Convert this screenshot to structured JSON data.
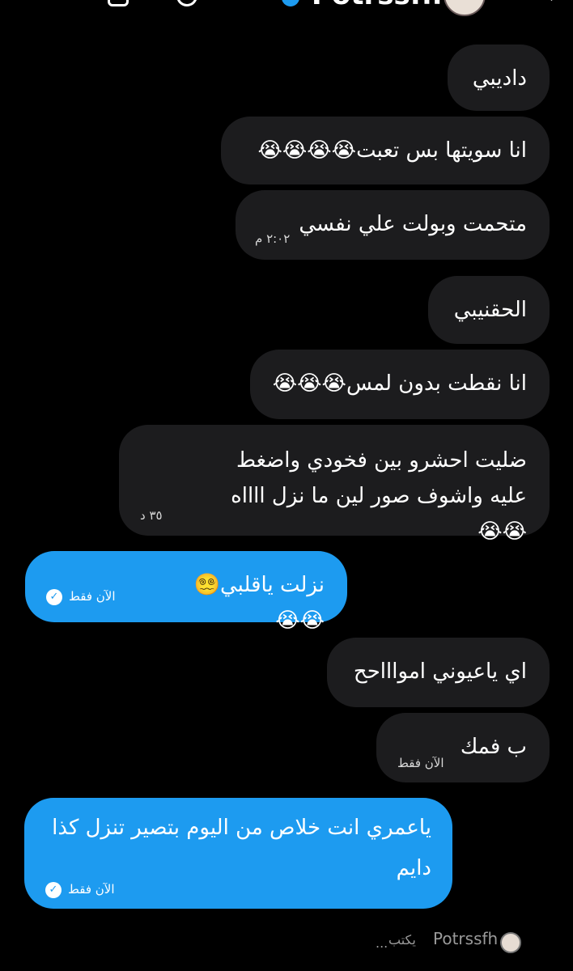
{
  "header": {
    "name": "Potrssfh"
  },
  "messages": [
    {
      "text": "داديبي",
      "emoji": "",
      "meta": ""
    },
    {
      "text": "انا سويتها بس تعبت",
      "emoji": "😭😭😭😭",
      "meta": ""
    },
    {
      "text": "متحمت وبولت علي نفسي",
      "emoji": "",
      "meta": "٢:٠٢ م"
    },
    {
      "text": "الحقنيبي",
      "emoji": "",
      "meta": ""
    },
    {
      "text": "انا نقطت بدون لمس",
      "emoji": "😭😭😭",
      "meta": ""
    },
    {
      "text": "ضليت احشرو بين فخودي واضغط عليه واشوف صور لين ما نزل ااااه",
      "emoji": "😭😭",
      "meta": "٣٥ د"
    },
    {
      "text": "نزلت ياقلبي",
      "emoji": "😵‍💫😭😭",
      "meta": "الآن فقط"
    },
    {
      "text": "اي ياعيوني امواااحح",
      "emoji": "",
      "meta": ""
    },
    {
      "text": "ب فمك",
      "emoji": "",
      "meta": "الآن فقط"
    },
    {
      "text": "ياعمري انت خلاص من اليوم بتصير تنزل كذا دايم",
      "emoji": "",
      "meta": "الآن فقط"
    }
  ],
  "typing": {
    "username": "Potrssfh",
    "label": "يكتب",
    "dots": "..."
  }
}
